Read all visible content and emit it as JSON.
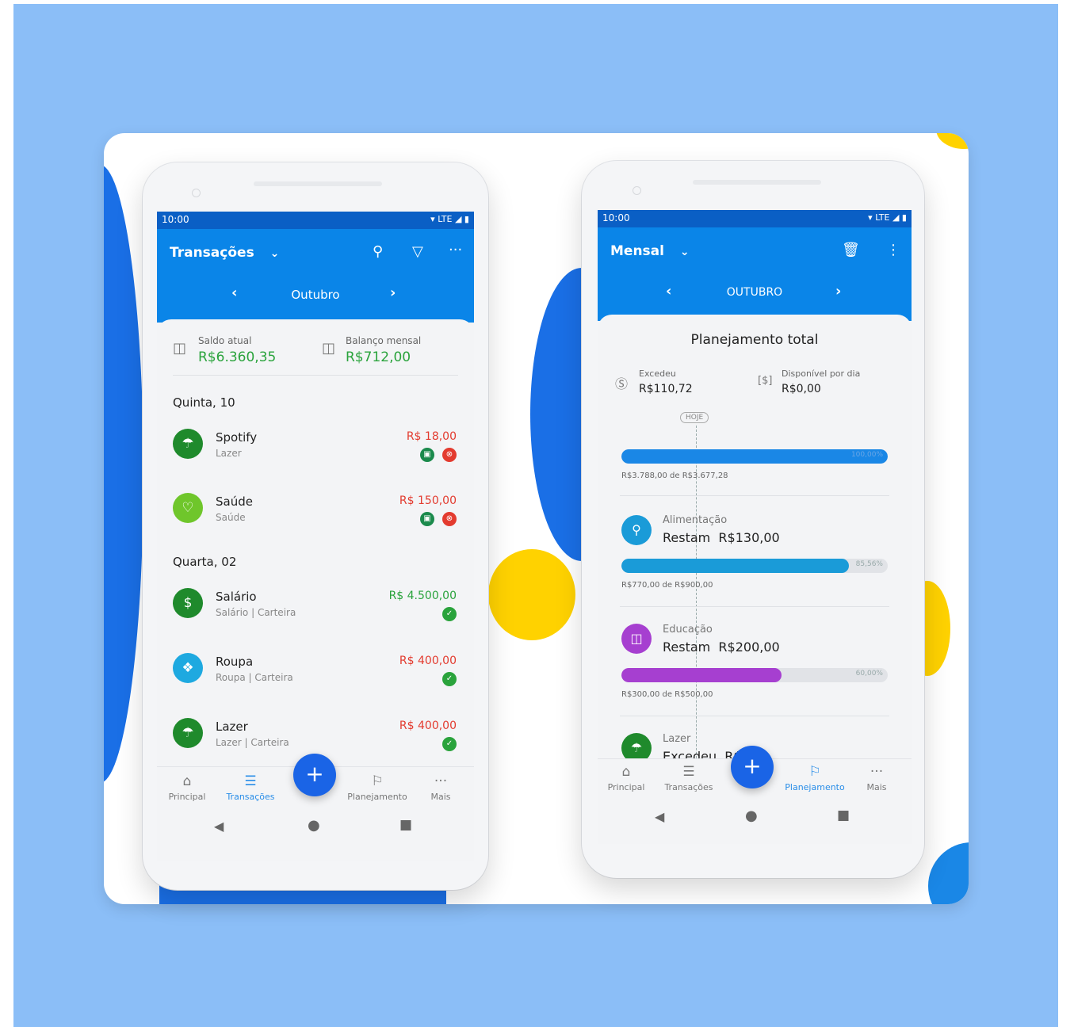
{
  "colors": {
    "background": "#8bbef7",
    "brand": "#0a85e8",
    "accent_yellow": "#ffd200",
    "positive": "#2aa33c",
    "negative": "#e33b2f",
    "fab": "#1a64e6"
  },
  "left": {
    "status": {
      "time": "10:00",
      "network": "LTE"
    },
    "title": "Transações",
    "month": "Outubro",
    "icons": [
      "search-icon",
      "filter-icon",
      "more-icon"
    ],
    "summary": {
      "balance_label": "Saldo atual",
      "balance_value": "R$6.360,35",
      "monthly_label": "Balanço mensal",
      "monthly_value": "R$712,00"
    },
    "days": [
      {
        "label": "Quinta, 10"
      },
      {
        "label": "Quarta, 02"
      }
    ],
    "transactions": [
      {
        "name": "Spotify",
        "sub": "Lazer",
        "value": "R$ 18,00",
        "type": "expense",
        "icon": "umbrella-icon",
        "color": "#1f8a2c"
      },
      {
        "name": "Saúde",
        "sub": "Saúde",
        "value": "R$ 150,00",
        "type": "expense",
        "icon": "heart-icon",
        "color": "#6fc62b"
      },
      {
        "name": "Salário",
        "sub": "Salário | Carteira",
        "value": "R$ 4.500,00",
        "type": "income",
        "icon": "money-icon",
        "color": "#1f8a2c"
      },
      {
        "name": "Roupa",
        "sub": "Roupa | Carteira",
        "value": "R$ 400,00",
        "type": "expense",
        "icon": "shirt-icon",
        "color": "#1ea9e0"
      },
      {
        "name": "Lazer",
        "sub": "Lazer | Carteira",
        "value": "R$ 400,00",
        "type": "expense",
        "icon": "umbrella-icon",
        "color": "#1f8a2c"
      }
    ],
    "nav": [
      {
        "label": "Principal",
        "icon": "home-icon",
        "active": false
      },
      {
        "label": "Transações",
        "icon": "list-icon",
        "active": true
      },
      {
        "label": "Planejamento",
        "icon": "flag-icon",
        "active": false
      },
      {
        "label": "Mais",
        "icon": "more-icon",
        "active": false
      }
    ],
    "fab": "+"
  },
  "right": {
    "status": {
      "time": "10:00",
      "network": "LTE"
    },
    "title": "Mensal",
    "month": "OUTUBRO",
    "icons": [
      "trash-icon",
      "kebab-icon"
    ],
    "heading": "Planejamento total",
    "exceeded_label": "Excedeu",
    "exceeded_value": "R$110,72",
    "daily_label": "Disponível por dia",
    "daily_value": "R$0,00",
    "today_label": "HOJE",
    "total_bar": {
      "fraction": 1.0,
      "color": "#1a87e6",
      "pct": "100,00%",
      "caption": "R$3.788,00 de R$3.677,28"
    },
    "categories": [
      {
        "name": "Alimentação",
        "status": "Restam",
        "amount": "R$130,00",
        "fraction": 0.8556,
        "pct": "85,56%",
        "caption": "R$770,00 de R$900,00",
        "color": "#1a9bd8",
        "icon": "cutlery-icon"
      },
      {
        "name": "Educação",
        "status": "Restam",
        "amount": "R$200,00",
        "fraction": 0.6,
        "pct": "60,00%",
        "caption": "R$300,00 de R$500,00",
        "color": "#a63fd0",
        "icon": "book-icon"
      },
      {
        "name": "Lazer",
        "status": "Excedeu",
        "amount": "R$",
        "icon": "umbrella-icon",
        "color": "#1f8a2c"
      }
    ],
    "nav": [
      {
        "label": "Principal",
        "icon": "home-icon",
        "active": false
      },
      {
        "label": "Transações",
        "icon": "list-icon",
        "active": false
      },
      {
        "label": "Planejamento",
        "icon": "flag-icon",
        "active": true
      },
      {
        "label": "Mais",
        "icon": "more-icon",
        "active": false
      }
    ],
    "fab": "+"
  }
}
